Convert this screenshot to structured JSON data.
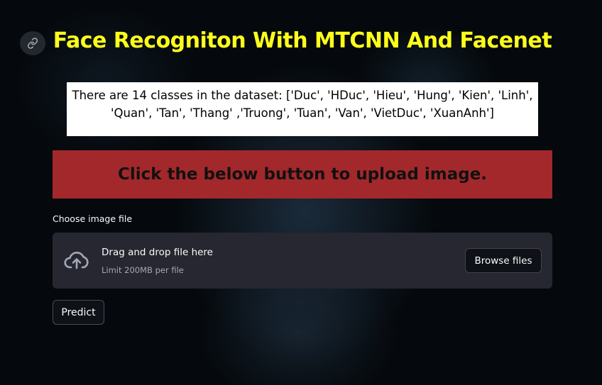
{
  "header": {
    "title": "Face Recogniton With MTCNN And Facenet",
    "link_icon": "link-icon"
  },
  "info": {
    "classes_text": "There are 14 classes in the dataset: ['Duc', 'HDuc', 'Hieu', 'Hung', 'Kien', 'Linh', 'Quan', 'Tan', 'Thang' ,'Truong', 'Tuan', 'Van', 'VietDuc', 'XuanAnh']"
  },
  "banner": {
    "text": "Click the below button to upload image."
  },
  "uploader": {
    "label": "Choose image file",
    "drop_text": "Drag and drop file here",
    "limit_text": "Limit 200MB per file",
    "browse_label": "Browse files",
    "icon": "cloud-upload-icon"
  },
  "actions": {
    "predict_label": "Predict"
  },
  "colors": {
    "title": "#ffff1a",
    "banner_bg": "#a3282b",
    "dropzone_bg": "#262730",
    "page_bg": "#05090d"
  }
}
